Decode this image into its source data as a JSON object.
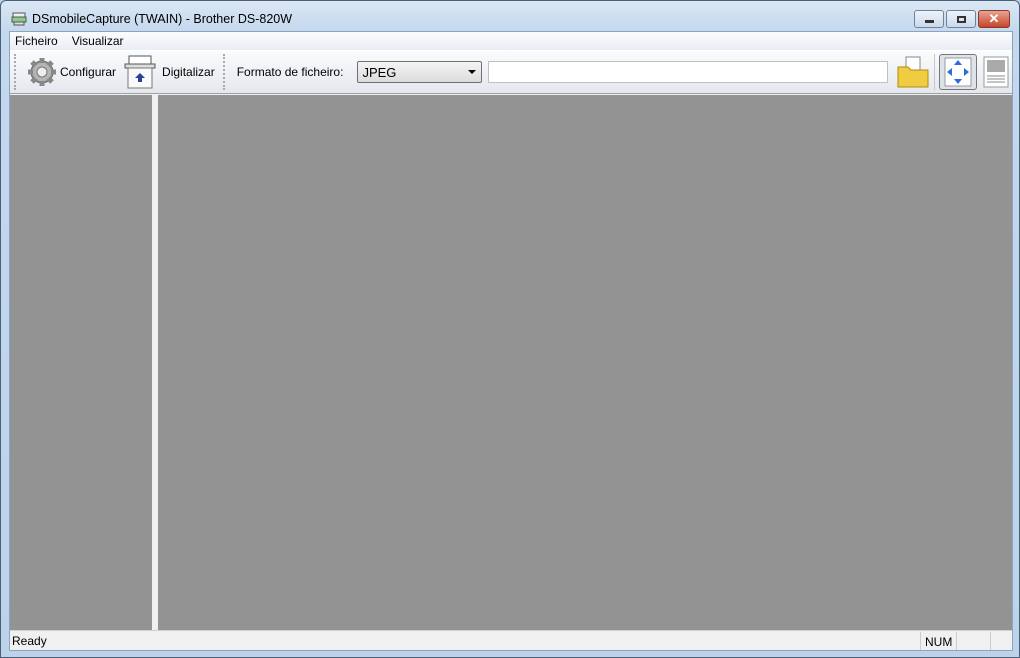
{
  "window": {
    "title": "DSmobileCapture (TWAIN) - Brother DS-820W",
    "minimize": "▭",
    "maximize": "□",
    "close": "✕"
  },
  "menu": [
    {
      "label": "Ficheiro"
    },
    {
      "label": "Visualizar"
    }
  ],
  "toolbar": {
    "configure_label": "Configurar",
    "scan_label": "Digitalizar",
    "format_label": "Formato de ficheiro:",
    "format_value": "JPEG",
    "path_value": ""
  },
  "status": {
    "text": "Ready",
    "num": "NUM"
  },
  "colors": {
    "panel": "#939393",
    "accent": "#2a6fd6"
  }
}
